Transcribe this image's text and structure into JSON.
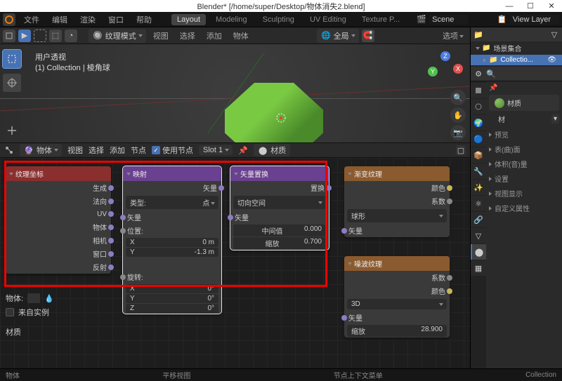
{
  "window": {
    "title": "Blender* [/home/super/Desktop/物体消失2.blend]"
  },
  "menubar": {
    "menus": [
      "文件",
      "编辑",
      "渲染",
      "窗口",
      "帮助"
    ],
    "tabs": [
      "Layout",
      "Modeling",
      "Sculpting",
      "UV Editing",
      "Texture P..."
    ],
    "active_tab": "Layout",
    "scene_label": "Scene",
    "viewlayer_label": "View Layer"
  },
  "header3d": {
    "mode": "纹理模式",
    "menus": [
      "视图",
      "选择",
      "添加",
      "物体"
    ],
    "options_label": "选项"
  },
  "viewport": {
    "overlay_line1": "用户透视",
    "overlay_line2": "(1) Collection | 棱角球"
  },
  "node_header": {
    "editor_type": "物体",
    "menus": [
      "视图",
      "选择",
      "添加",
      "节点"
    ],
    "use_nodes_label": "使用节点",
    "slot": "Slot 1",
    "material": "材质"
  },
  "nodes": {
    "texcoord": {
      "title": "纹理坐标",
      "outputs": [
        "生成",
        "法向",
        "UV",
        "物体",
        "相机",
        "窗口",
        "反射"
      ],
      "object_label": "物体:",
      "from_instancer": "来自实例",
      "material_label": "材质"
    },
    "mapping": {
      "title": "映射",
      "out_vector": "矢量",
      "type_label": "类型:",
      "type_value": "点",
      "in_vector": "矢量",
      "location_label": "位置:",
      "loc_x_label": "X",
      "loc_x": "0 m",
      "loc_y_label": "Y",
      "loc_y": "-1.3 m",
      "rotation_label": "旋转:",
      "rot_x_label": "X",
      "rot_x": "0°",
      "rot_y_label": "Y",
      "rot_y": "0°",
      "rot_z_label": "Z",
      "rot_z": "0°"
    },
    "displacement": {
      "title": "矢量置换",
      "out_label": "置换",
      "space": "切向空间",
      "in_vector": "矢量",
      "midlevel_label": "中间值",
      "midlevel": "0.000",
      "scale_label": "缩放",
      "scale": "0.700"
    },
    "gradient": {
      "title": "渐变纹理",
      "out_color": "颜色",
      "out_fac": "系数",
      "type": "球形",
      "in_vector": "矢量"
    },
    "noise": {
      "title": "噪波纹理",
      "out_fac": "系数",
      "out_color": "颜色",
      "dim": "3D",
      "in_vector": "矢量",
      "scale_label": "缩放",
      "scale": "28.900"
    }
  },
  "outliner": {
    "scene_collection": "场景集合",
    "collection": "Collectio..."
  },
  "properties": {
    "material_slot": "材质",
    "mat_breadcrumb": "材",
    "sections": [
      "预览",
      "表(曲)面",
      "体积(音)量",
      "设置",
      "视图显示",
      "自定义属性"
    ]
  },
  "statusbar": {
    "item1": "物体",
    "item2": "平移视图",
    "item3": "节点上下文菜单",
    "item4": "Collection"
  }
}
